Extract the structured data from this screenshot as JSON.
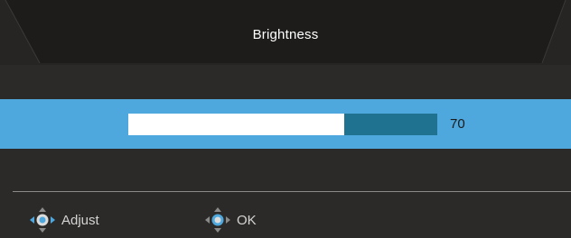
{
  "osd": {
    "title": "Brightness",
    "value": 70,
    "value_label": "70",
    "accent_color": "#4ea8de",
    "track_color": "#1f7390",
    "background_color": "#2b2a28"
  },
  "footer": {
    "adjust": {
      "icon": "joystick-left-right-icon",
      "label": "Adjust"
    },
    "ok": {
      "icon": "joystick-press-icon",
      "label": "OK"
    }
  }
}
